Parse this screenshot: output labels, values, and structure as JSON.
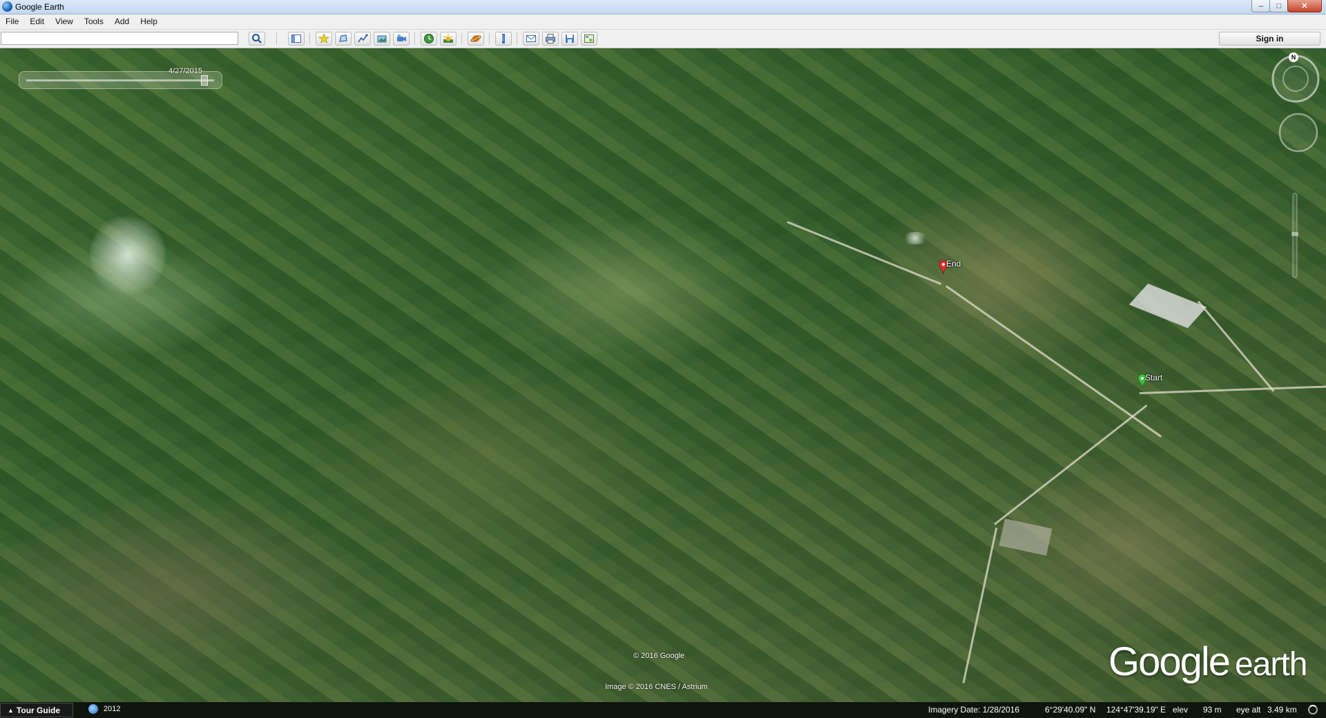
{
  "window": {
    "title": "Google Earth",
    "controls": {
      "minimize": "–",
      "maximize": "□",
      "close": "✕"
    }
  },
  "menu": [
    "File",
    "Edit",
    "View",
    "Tools",
    "Add",
    "Help"
  ],
  "toolbar": {
    "search_value": "",
    "sign_in_label": "Sign in",
    "buttons": [
      {
        "name": "search-button",
        "icon": "search-icon"
      },
      {
        "name": "sidebar-toggle-button",
        "icon": "sidebar-icon"
      },
      {
        "name": "add-placemark-button",
        "icon": "pushpin-icon"
      },
      {
        "name": "add-polygon-button",
        "icon": "polygon-icon"
      },
      {
        "name": "add-path-button",
        "icon": "path-icon"
      },
      {
        "name": "add-image-overlay-button",
        "icon": "image-overlay-icon"
      },
      {
        "name": "record-tour-button",
        "icon": "record-tour-icon"
      },
      {
        "name": "historical-imagery-button",
        "icon": "clock-icon"
      },
      {
        "name": "sunlight-button",
        "icon": "sun-icon"
      },
      {
        "name": "switch-planet-button",
        "icon": "planet-icon"
      },
      {
        "name": "ruler-button",
        "icon": "ruler-icon"
      },
      {
        "name": "email-button",
        "icon": "email-icon"
      },
      {
        "name": "print-button",
        "icon": "print-icon"
      },
      {
        "name": "save-image-button",
        "icon": "save-image-icon"
      },
      {
        "name": "view-in-maps-button",
        "icon": "maps-icon"
      }
    ]
  },
  "viewport": {
    "time_slider_date": "4/27/2015",
    "placemarks": [
      {
        "label": "End",
        "color": "#e0312a"
      },
      {
        "label": "Start",
        "color": "#3cc23c"
      }
    ],
    "compass_north": "N",
    "copyright_google": "© 2016 Google",
    "copyright_image": "Image © 2016 CNES / Astrium",
    "logo_google": "Google",
    "logo_earth": "earth"
  },
  "status": {
    "tour_guide_label": "Tour Guide",
    "history_year": "2012",
    "imagery_date": "Imagery Date: 1/28/2016",
    "latitude": "6°29'40.09\" N",
    "longitude": "124°47'39.19\" E",
    "elev_label": "elev",
    "elev_value": "93 m",
    "eye_alt_label": "eye alt",
    "eye_alt_value": "3.49 km"
  }
}
